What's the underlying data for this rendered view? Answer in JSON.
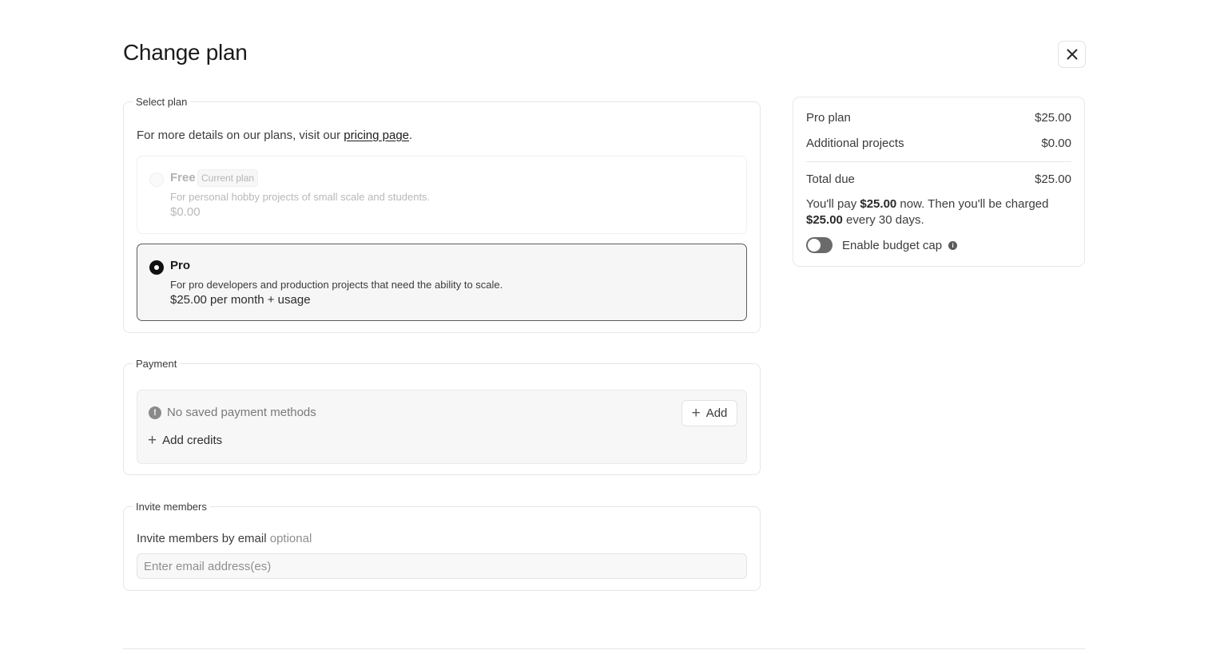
{
  "page": {
    "title": "Change plan"
  },
  "select_plan": {
    "legend": "Select plan",
    "intro_prefix": "For more details on our plans, visit our ",
    "intro_link": "pricing page",
    "intro_suffix": ".",
    "plans": [
      {
        "name": "Free",
        "badge": "Current plan",
        "description": "For personal hobby projects of small scale and students.",
        "price": "$0.00",
        "selected": false
      },
      {
        "name": "Pro",
        "description": "For pro developers and production projects that need the ability to scale.",
        "price": "$25.00 per month + usage",
        "selected": true
      }
    ]
  },
  "payment": {
    "legend": "Payment",
    "status": "No saved payment methods",
    "add_label": "Add",
    "add_credits_label": "Add credits"
  },
  "invite": {
    "legend": "Invite members",
    "label": "Invite members by email",
    "optional": "optional",
    "placeholder": "Enter email address(es)"
  },
  "summary": {
    "rows": [
      {
        "label": "Pro plan",
        "value": "$25.00"
      },
      {
        "label": "Additional projects",
        "value": "$0.00"
      }
    ],
    "total_label": "Total due",
    "total_value": "$25.00",
    "note_1": "You'll pay ",
    "note_amount_1": "$25.00",
    "note_2": " now. Then you'll be charged ",
    "note_amount_2": "$25.00",
    "note_3": " every 30 days.",
    "budget_cap_label": "Enable budget cap",
    "budget_cap_enabled": false
  },
  "icons": {
    "close": "close-icon",
    "warning": "exclamation-circle-icon",
    "plus": "plus-icon",
    "info": "info-icon"
  },
  "colors": {
    "selected_radio": "#111111",
    "toggle_off": "#6a6a6a"
  }
}
